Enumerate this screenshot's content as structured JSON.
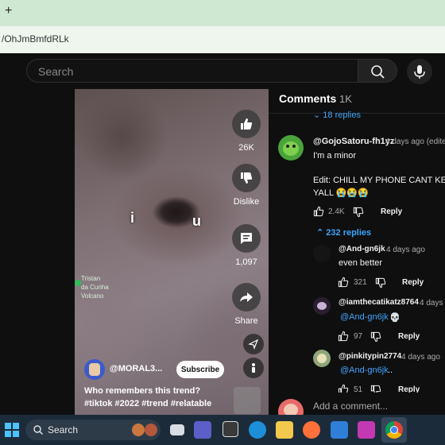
{
  "browser": {
    "new_tab": "+",
    "url": "/OhJmBmfdRLk"
  },
  "header": {
    "search_placeholder": "Search",
    "search_icon": "search-icon",
    "mic_icon": "mic-icon"
  },
  "video": {
    "overlay_left": "i",
    "overlay_right": "u",
    "map_label": [
      "Tristan",
      "da Cunha",
      "Volcano"
    ],
    "actions": {
      "like_count": "26K",
      "dislike_label": "Dislike",
      "comment_count": "1,097",
      "share_label": "Share"
    },
    "channel_name": "@MORAL3...",
    "subscribe_label": "Subscribe",
    "caption_line1": "Who remembers this trend?",
    "caption_line2": "#tiktok #2022 #trend #relatable"
  },
  "comments": {
    "title": "Comments",
    "count": "1K",
    "prev_replies": "18 replies",
    "thread": {
      "author": "@GojoSatoru-fh1yz",
      "time": "4 days ago (edite",
      "line1": "I'm a minor",
      "line2": "Edit: CHILL MY PHONE CANT KEE",
      "line3": "YALL 😭😭😭",
      "likes": "2.4K",
      "reply_label": "Reply",
      "replies_toggle": "232 replies"
    },
    "replies": [
      {
        "author": "@And-gn6jk",
        "time": "4 days ago",
        "mention": "",
        "text": "even better",
        "likes": "321",
        "reply_label": "Reply"
      },
      {
        "author": "@iamthecatikatz8764",
        "time": "4 days a",
        "mention": "@And-gn6jk",
        "text": "💀",
        "likes": "97",
        "reply_label": "Reply"
      },
      {
        "author": "@pinkitypin2774",
        "time": "4 days ago",
        "mention": "@And-gn6jk",
        "text": "..",
        "likes": "51",
        "reply_label": "Reply"
      }
    ],
    "add_comment_placeholder": "Add a comment..."
  },
  "taskbar": {
    "search_label": "Search"
  },
  "colors": {
    "accent_blue": "#3ea6ff",
    "bg": "#0f0f0f"
  }
}
